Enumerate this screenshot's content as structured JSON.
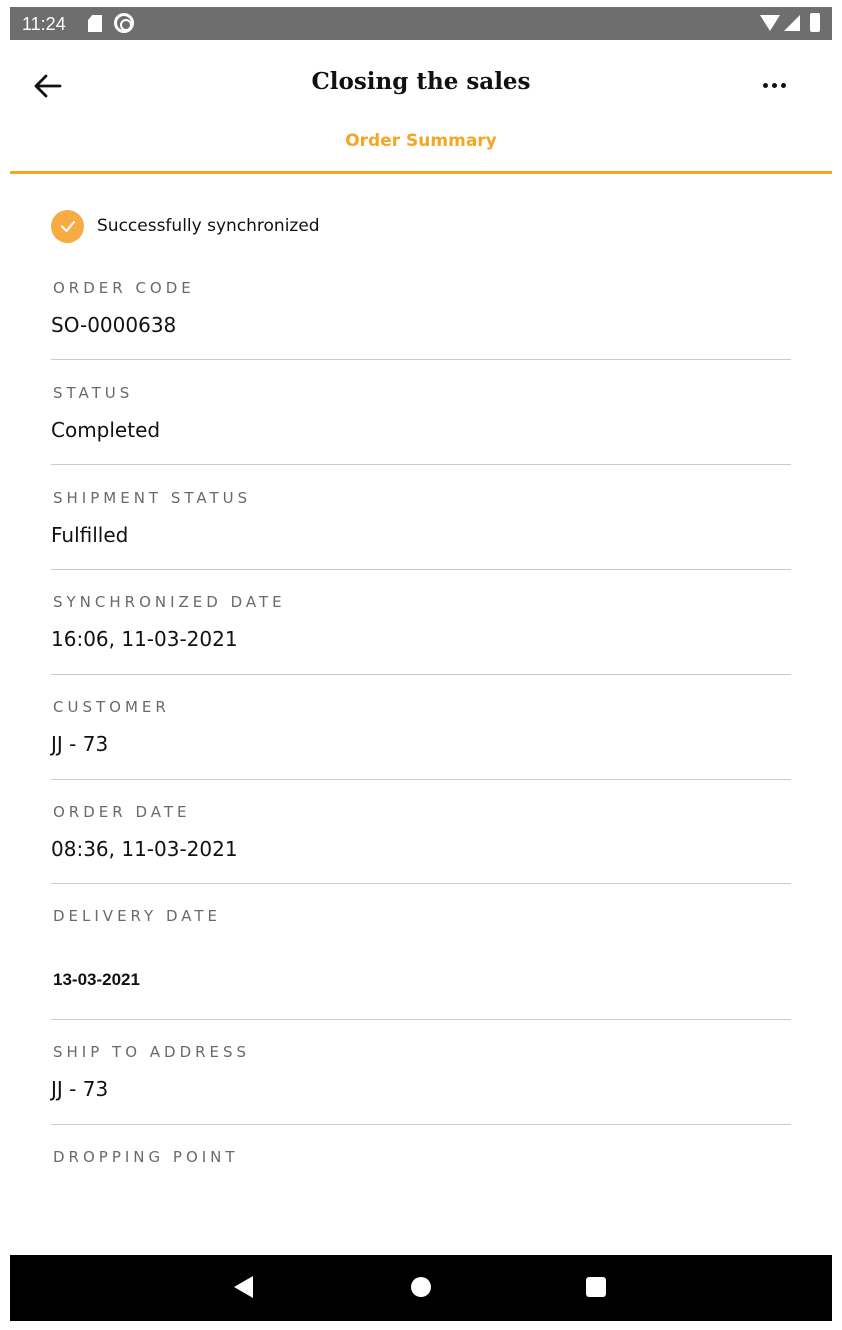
{
  "status_bar": {
    "time": "11:24"
  },
  "app_bar": {
    "title": "Closing the sales"
  },
  "tab": {
    "label": "Order Summary"
  },
  "sync": {
    "message": "Successfully synchronized"
  },
  "fields": [
    {
      "label": "ORDER CODE",
      "value": "SO-0000638"
    },
    {
      "label": "STATUS",
      "value": "Completed"
    },
    {
      "label": "SHIPMENT STATUS",
      "value": "Fulfilled"
    },
    {
      "label": "SYNCHRONIZED DATE",
      "value": "16:06, 11-03-2021"
    },
    {
      "label": "CUSTOMER",
      "value": "JJ - 73"
    },
    {
      "label": "ORDER DATE",
      "value": "08:36, 11-03-2021"
    },
    {
      "label": "DELIVERY DATE",
      "value": "13-03-2021"
    },
    {
      "label": "SHIP TO ADDRESS",
      "value": "JJ - 73"
    },
    {
      "label": "DROPPING POINT",
      "value": ""
    }
  ],
  "colors": {
    "accent": "#f5a623",
    "status_bar": "#6e6e6e",
    "divider": "#c9c9c9"
  }
}
